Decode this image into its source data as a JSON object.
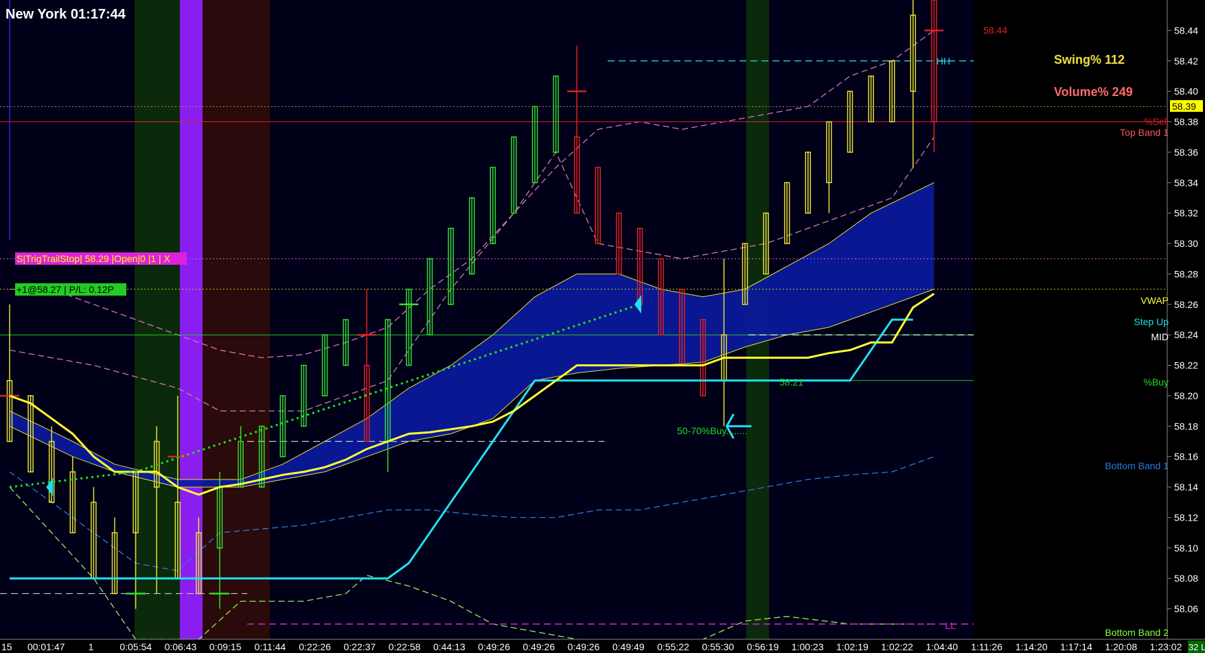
{
  "header": {
    "title": "New York 01:17:44"
  },
  "stats": {
    "swing": "Swing% 112",
    "volume": "Volume% 249"
  },
  "colors": {
    "background": "#000018",
    "bull_bar": "#33dd33",
    "bear_bar": "#dd2222",
    "neutral_bar": "#e6e030",
    "vwap": "#ffff33",
    "step_up": "#22e0ee",
    "band_fill": "#0a1aa0",
    "sell_line": "#dd2222",
    "buy_line": "#22cc22"
  },
  "chart_data": {
    "type": "line",
    "title": "",
    "xlabel": "",
    "ylabel": "",
    "ylim": [
      58.04,
      58.46
    ],
    "y_ticks": [
      "58.44",
      "58.42",
      "58.40",
      "58.38",
      "58.36",
      "58.34",
      "58.32",
      "58.30",
      "58.28",
      "58.26",
      "58.24",
      "58.22",
      "58.20",
      "58.18",
      "58.16",
      "58.14",
      "58.12",
      "58.10",
      "58.08",
      "58.06"
    ],
    "x_ticks": [
      "15",
      "00:01:47",
      "1",
      "0:05:54",
      "0:06:43",
      "0:09:15",
      "0:11:44",
      "0:22:26",
      "0:22:37",
      "0:22:58",
      "0:44:13",
      "0:49:26",
      "0:49:26",
      "0:49:26",
      "0:49:49",
      "0:55:22",
      "0:55:30",
      "0:56:19",
      "1:00:23",
      "1:02:19",
      "1:02:22",
      "1:04:40",
      "1:11:26",
      "1:14:20",
      "1:17:14",
      "1:20:08",
      "1:23:02"
    ],
    "corner_label": "32 L",
    "current_price": "58.39",
    "high_marker": "58.44",
    "bars": [
      {
        "x": 0,
        "o": 58.21,
        "h": 58.26,
        "l": 58.17,
        "c": 58.17,
        "t": "y"
      },
      {
        "x": 1,
        "o": 58.2,
        "h": 58.2,
        "l": 58.15,
        "c": 58.15,
        "t": "y"
      },
      {
        "x": 2,
        "o": 58.17,
        "h": 58.18,
        "l": 58.13,
        "c": 58.13,
        "t": "y"
      },
      {
        "x": 3,
        "o": 58.15,
        "h": 58.16,
        "l": 58.11,
        "c": 58.11,
        "t": "y"
      },
      {
        "x": 4,
        "o": 58.13,
        "h": 58.14,
        "l": 58.08,
        "c": 58.08,
        "t": "y"
      },
      {
        "x": 5,
        "o": 58.11,
        "h": 58.12,
        "l": 58.07,
        "c": 58.07,
        "t": "y"
      },
      {
        "x": 6,
        "o": 58.15,
        "h": 58.15,
        "l": 58.06,
        "c": 58.11,
        "t": "y"
      },
      {
        "x": 7,
        "o": 58.14,
        "h": 58.18,
        "l": 58.07,
        "c": 58.17,
        "t": "y"
      },
      {
        "x": 8,
        "o": 58.13,
        "h": 58.2,
        "l": 58.08,
        "c": 58.08,
        "t": "y"
      },
      {
        "x": 9,
        "o": 58.11,
        "h": 58.12,
        "l": 58.07,
        "c": 58.07,
        "t": "y"
      },
      {
        "x": 10,
        "o": 58.1,
        "h": 58.15,
        "l": 58.06,
        "c": 58.14,
        "t": "g"
      },
      {
        "x": 11,
        "o": 58.14,
        "h": 58.18,
        "l": 58.14,
        "c": 58.17,
        "t": "g"
      },
      {
        "x": 12,
        "o": 58.14,
        "h": 58.18,
        "l": 58.14,
        "c": 58.18,
        "t": "g"
      },
      {
        "x": 13,
        "o": 58.16,
        "h": 58.2,
        "l": 58.16,
        "c": 58.2,
        "t": "g"
      },
      {
        "x": 14,
        "o": 58.18,
        "h": 58.22,
        "l": 58.18,
        "c": 58.22,
        "t": "g"
      },
      {
        "x": 15,
        "o": 58.2,
        "h": 58.24,
        "l": 58.2,
        "c": 58.24,
        "t": "g"
      },
      {
        "x": 16,
        "o": 58.22,
        "h": 58.25,
        "l": 58.22,
        "c": 58.25,
        "t": "g"
      },
      {
        "x": 17,
        "o": 58.22,
        "h": 58.27,
        "l": 58.17,
        "c": 58.17,
        "t": "r"
      },
      {
        "x": 18,
        "o": 58.17,
        "h": 58.25,
        "l": 58.15,
        "c": 58.25,
        "t": "g"
      },
      {
        "x": 19,
        "o": 58.22,
        "h": 58.27,
        "l": 58.22,
        "c": 58.27,
        "t": "g"
      },
      {
        "x": 20,
        "o": 58.24,
        "h": 58.29,
        "l": 58.24,
        "c": 58.29,
        "t": "g"
      },
      {
        "x": 21,
        "o": 58.26,
        "h": 58.31,
        "l": 58.26,
        "c": 58.31,
        "t": "g"
      },
      {
        "x": 22,
        "o": 58.28,
        "h": 58.33,
        "l": 58.28,
        "c": 58.33,
        "t": "g"
      },
      {
        "x": 23,
        "o": 58.3,
        "h": 58.35,
        "l": 58.3,
        "c": 58.35,
        "t": "g"
      },
      {
        "x": 24,
        "o": 58.32,
        "h": 58.37,
        "l": 58.32,
        "c": 58.37,
        "t": "g"
      },
      {
        "x": 25,
        "o": 58.34,
        "h": 58.39,
        "l": 58.34,
        "c": 58.39,
        "t": "g"
      },
      {
        "x": 26,
        "o": 58.36,
        "h": 58.41,
        "l": 58.36,
        "c": 58.41,
        "t": "g"
      },
      {
        "x": 27,
        "o": 58.37,
        "h": 58.43,
        "l": 58.32,
        "c": 58.32,
        "t": "r"
      },
      {
        "x": 28,
        "o": 58.35,
        "h": 58.35,
        "l": 58.3,
        "c": 58.3,
        "t": "r"
      },
      {
        "x": 29,
        "o": 58.32,
        "h": 58.32,
        "l": 58.28,
        "c": 58.28,
        "t": "r"
      },
      {
        "x": 30,
        "o": 58.31,
        "h": 58.31,
        "l": 58.26,
        "c": 58.26,
        "t": "r"
      },
      {
        "x": 31,
        "o": 58.29,
        "h": 58.29,
        "l": 58.24,
        "c": 58.24,
        "t": "r"
      },
      {
        "x": 32,
        "o": 58.27,
        "h": 58.27,
        "l": 58.22,
        "c": 58.22,
        "t": "r"
      },
      {
        "x": 33,
        "o": 58.25,
        "h": 58.25,
        "l": 58.2,
        "c": 58.2,
        "t": "r"
      },
      {
        "x": 34,
        "o": 58.21,
        "h": 58.29,
        "l": 58.18,
        "c": 58.24,
        "t": "y"
      },
      {
        "x": 35,
        "o": 58.26,
        "h": 58.3,
        "l": 58.26,
        "c": 58.3,
        "t": "y"
      },
      {
        "x": 36,
        "o": 58.28,
        "h": 58.32,
        "l": 58.28,
        "c": 58.32,
        "t": "y"
      },
      {
        "x": 37,
        "o": 58.3,
        "h": 58.34,
        "l": 58.3,
        "c": 58.34,
        "t": "y"
      },
      {
        "x": 38,
        "o": 58.32,
        "h": 58.36,
        "l": 58.32,
        "c": 58.36,
        "t": "y"
      },
      {
        "x": 39,
        "o": 58.34,
        "h": 58.38,
        "l": 58.32,
        "c": 58.38,
        "t": "y"
      },
      {
        "x": 40,
        "o": 58.36,
        "h": 58.4,
        "l": 58.36,
        "c": 58.4,
        "t": "y"
      },
      {
        "x": 41,
        "o": 58.38,
        "h": 58.41,
        "l": 58.38,
        "c": 58.41,
        "t": "y"
      },
      {
        "x": 42,
        "o": 58.38,
        "h": 58.42,
        "l": 58.38,
        "c": 58.42,
        "t": "y"
      },
      {
        "x": 43,
        "o": 58.4,
        "h": 58.46,
        "l": 58.35,
        "c": 58.45,
        "t": "y"
      },
      {
        "x": 44,
        "o": 58.46,
        "h": 58.46,
        "l": 58.36,
        "c": 58.38,
        "t": "r"
      }
    ],
    "vwap": [
      [
        0,
        58.2
      ],
      [
        1,
        58.195
      ],
      [
        2,
        58.185
      ],
      [
        3,
        58.175
      ],
      [
        4,
        58.16
      ],
      [
        5,
        58.15
      ],
      [
        6,
        58.15
      ],
      [
        7,
        58.15
      ],
      [
        8,
        58.14
      ],
      [
        9,
        58.135
      ],
      [
        10,
        58.14
      ],
      [
        11,
        58.142
      ],
      [
        12,
        58.145
      ],
      [
        13,
        58.148
      ],
      [
        14,
        58.15
      ],
      [
        15,
        58.153
      ],
      [
        16,
        58.158
      ],
      [
        17,
        58.165
      ],
      [
        18,
        58.17
      ],
      [
        19,
        58.175
      ],
      [
        20,
        58.176
      ],
      [
        21,
        58.178
      ],
      [
        22,
        58.18
      ],
      [
        23,
        58.183
      ],
      [
        24,
        58.19
      ],
      [
        25,
        58.2
      ],
      [
        26,
        58.21
      ],
      [
        27,
        58.22
      ],
      [
        28,
        58.22
      ],
      [
        29,
        58.22
      ],
      [
        30,
        58.22
      ],
      [
        31,
        58.22
      ],
      [
        32,
        58.22
      ],
      [
        33,
        58.22
      ],
      [
        34,
        58.225
      ],
      [
        35,
        58.225
      ],
      [
        36,
        58.225
      ],
      [
        37,
        58.225
      ],
      [
        38,
        58.225
      ],
      [
        39,
        58.228
      ],
      [
        40,
        58.23
      ],
      [
        41,
        58.235
      ],
      [
        42,
        58.235
      ],
      [
        43,
        58.258
      ],
      [
        44,
        58.267
      ]
    ],
    "step_up": [
      [
        0,
        58.08
      ],
      [
        18,
        58.08
      ],
      [
        19,
        58.09
      ],
      [
        20,
        58.11
      ],
      [
        21,
        58.13
      ],
      [
        22,
        58.15
      ],
      [
        23,
        58.17
      ],
      [
        24,
        58.19
      ],
      [
        25,
        58.21
      ],
      [
        40,
        58.21
      ],
      [
        41,
        58.23
      ],
      [
        42,
        58.25
      ],
      [
        43,
        58.25
      ]
    ],
    "band_upper": [
      [
        0,
        58.19
      ],
      [
        3,
        58.17
      ],
      [
        5,
        58.155
      ],
      [
        8,
        58.145
      ],
      [
        11,
        58.145
      ],
      [
        13,
        58.155
      ],
      [
        15,
        58.17
      ],
      [
        17,
        58.185
      ],
      [
        19,
        58.205
      ],
      [
        21,
        58.22
      ],
      [
        23,
        58.24
      ],
      [
        25,
        58.265
      ],
      [
        27,
        58.28
      ],
      [
        29,
        58.28
      ],
      [
        31,
        58.27
      ],
      [
        33,
        58.265
      ],
      [
        35,
        58.27
      ],
      [
        37,
        58.285
      ],
      [
        39,
        58.3
      ],
      [
        41,
        58.32
      ],
      [
        44,
        58.34
      ]
    ],
    "band_lower": [
      [
        0,
        58.18
      ],
      [
        3,
        58.16
      ],
      [
        5,
        58.15
      ],
      [
        8,
        58.14
      ],
      [
        11,
        58.14
      ],
      [
        13,
        58.145
      ],
      [
        15,
        58.15
      ],
      [
        17,
        58.16
      ],
      [
        19,
        58.17
      ],
      [
        21,
        58.175
      ],
      [
        23,
        58.185
      ],
      [
        25,
        58.21
      ],
      [
        27,
        58.215
      ],
      [
        29,
        58.218
      ],
      [
        31,
        58.22
      ],
      [
        33,
        58.222
      ],
      [
        35,
        58.232
      ],
      [
        37,
        58.24
      ],
      [
        39,
        58.245
      ],
      [
        41,
        58.255
      ],
      [
        44,
        58.27
      ]
    ],
    "top_band": [
      [
        0,
        58.27
      ],
      [
        2,
        58.27
      ],
      [
        4,
        58.26
      ],
      [
        6,
        58.25
      ],
      [
        8,
        58.24
      ],
      [
        10,
        58.23
      ],
      [
        12,
        58.225
      ],
      [
        14,
        58.227
      ],
      [
        16,
        58.235
      ],
      [
        18,
        58.245
      ],
      [
        20,
        58.27
      ],
      [
        22,
        58.29
      ],
      [
        24,
        58.32
      ],
      [
        26,
        58.35
      ],
      [
        28,
        58.375
      ],
      [
        30,
        58.38
      ],
      [
        32,
        58.375
      ],
      [
        34,
        58.38
      ],
      [
        36,
        58.385
      ],
      [
        38,
        58.39
      ],
      [
        40,
        58.41
      ],
      [
        42,
        58.42
      ],
      [
        44,
        58.44
      ]
    ],
    "mid_band": [
      [
        0,
        58.23
      ],
      [
        4,
        58.22
      ],
      [
        8,
        58.205
      ],
      [
        10,
        58.19
      ],
      [
        14,
        58.19
      ],
      [
        18,
        58.21
      ],
      [
        21,
        58.27
      ],
      [
        24,
        58.32
      ],
      [
        26,
        58.36
      ],
      [
        28,
        58.3
      ],
      [
        30,
        58.295
      ],
      [
        32,
        58.29
      ],
      [
        34,
        58.295
      ],
      [
        36,
        58.3
      ],
      [
        38,
        58.31
      ],
      [
        40,
        58.32
      ],
      [
        42,
        58.33
      ],
      [
        44,
        58.37
      ]
    ],
    "bottom_band1": [
      [
        0,
        58.15
      ],
      [
        2,
        58.13
      ],
      [
        4,
        58.11
      ],
      [
        6,
        58.09
      ],
      [
        8,
        58.085
      ],
      [
        10,
        58.11
      ],
      [
        14,
        58.115
      ],
      [
        16,
        58.12
      ],
      [
        18,
        58.125
      ],
      [
        20,
        58.125
      ],
      [
        22,
        58.122
      ],
      [
        24,
        58.12
      ],
      [
        26,
        58.12
      ],
      [
        28,
        58.125
      ],
      [
        30,
        58.125
      ],
      [
        32,
        58.13
      ],
      [
        34,
        58.135
      ],
      [
        36,
        58.14
      ],
      [
        38,
        58.145
      ],
      [
        40,
        58.148
      ],
      [
        42,
        58.15
      ],
      [
        44,
        58.16
      ]
    ],
    "bottom_band2": [
      [
        0,
        58.14
      ],
      [
        2,
        58.11
      ],
      [
        4,
        58.08
      ],
      [
        6,
        58.04
      ],
      [
        9,
        58.04
      ],
      [
        11,
        58.065
      ],
      [
        14,
        58.065
      ],
      [
        16,
        58.07
      ],
      [
        17,
        58.082
      ],
      [
        19,
        58.075
      ],
      [
        21,
        58.065
      ],
      [
        23,
        58.05
      ],
      [
        25,
        58.045
      ],
      [
        27,
        58.04
      ],
      [
        30,
        58.035
      ],
      [
        33,
        58.04
      ],
      [
        35,
        58.052
      ],
      [
        37,
        58.055
      ],
      [
        40,
        58.05
      ],
      [
        44,
        58.05
      ]
    ],
    "levels": {
      "sell": 58.38,
      "sell_label": "%Sell",
      "top_band_label": "Top Band 1",
      "vwap_level": 58.27,
      "vwap_label": "VWAP",
      "step_up_label": "Step Up",
      "mid": 58.24,
      "mid_label": "MID",
      "buy": 58.21,
      "buy_label": "%Buy",
      "bottom_band1_label": "Bottom Band 1",
      "bottom_band2_label": "Bottom Band 2",
      "hh_level": 58.42,
      "hh_label": "HH",
      "ll_level": 58.05,
      "ll_label": "LL",
      "trail_level": 58.29,
      "orange_dotted": 58.39
    },
    "annotations": {
      "trail_stop": "S|TrigTrailStop| 58.29 |Open|0 |1 | X",
      "position": "+1@58.27 | P/L: 0.12P",
      "buy_zone": "50-70%Buy........",
      "buy_value": "58.21"
    },
    "trend_line": [
      [
        0,
        58.14
      ],
      [
        6,
        58.15
      ],
      [
        30,
        58.26
      ]
    ]
  }
}
